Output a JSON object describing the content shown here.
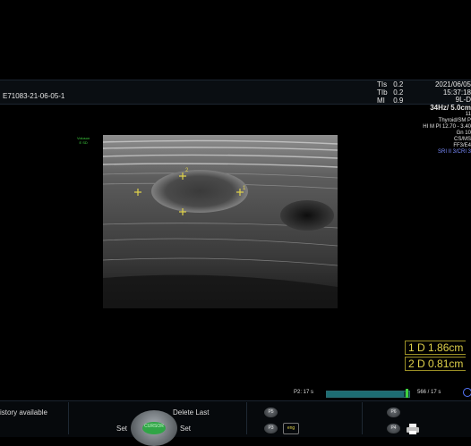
{
  "header": {
    "patient_id": "E71083-21-06-05-1",
    "tis_label": "TIs",
    "tis_value": "0.2",
    "tib_label": "TIb",
    "tib_value": "0.2",
    "mi_label": "MI",
    "mi_value": "0.9",
    "date": "2021/06/05",
    "time": "15:37:18"
  },
  "params": {
    "probe": "9L-D",
    "frame_depth": "34Hz/ 5.0cm",
    "line1": "11",
    "preset": "Thyroid/SM P",
    "power": "HI M PI 12.70 - 3.40",
    "gain": "Gn 10",
    "cs": "CS/MS",
    "ff": "FF3/E4",
    "sri": "SRI II 3/CRI 3"
  },
  "volusion": {
    "line1": "Voluson",
    "line2": "E SD"
  },
  "measurements": [
    {
      "label": "1 D",
      "value": "1.86cm"
    },
    {
      "label": "2 D",
      "value": "0.81cm"
    }
  ],
  "cine": {
    "label": "P2:  17 s",
    "counter": "566 / 17 s",
    "progress": 0.95
  },
  "bottom": {
    "history": "istory available",
    "delete_last": "Delete Last",
    "set_left": "Set",
    "set_right": "Set",
    "knob": "CURSOR",
    "p5": "P5",
    "p3": "P3",
    "p6": "P6",
    "p4": "P4",
    "eng": "eng"
  },
  "colors": {
    "measure": "#e0d24a",
    "sri": "#7a8cff",
    "volusion": "#3fd13f"
  }
}
